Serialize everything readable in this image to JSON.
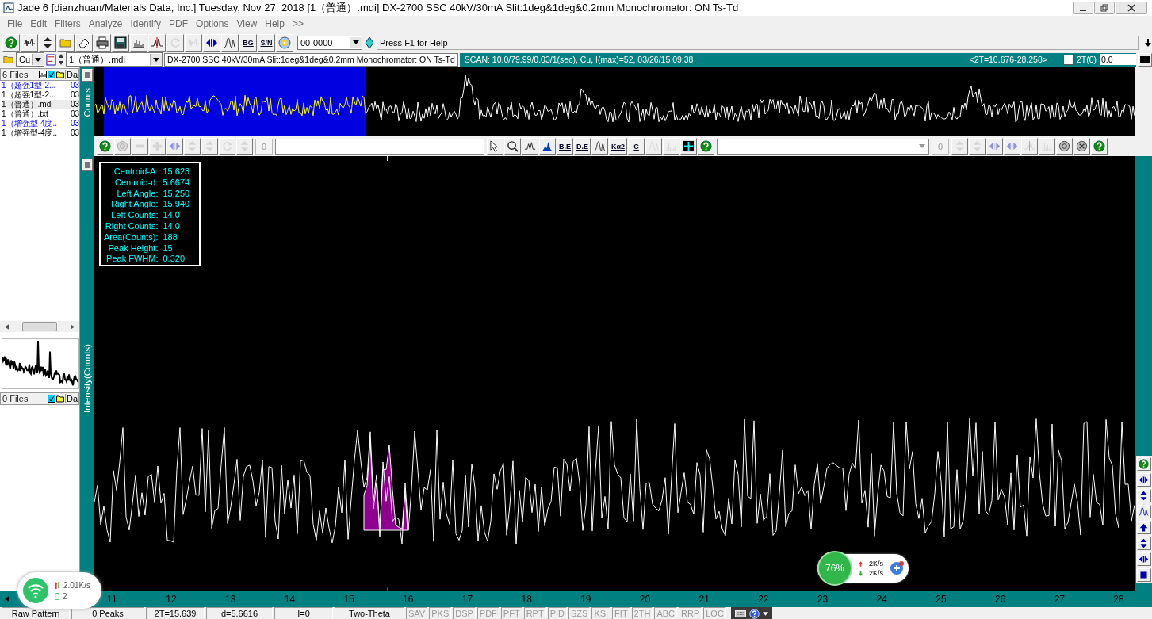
{
  "window": {
    "title": "Jade 6 [dianzhuan/Materials Data, Inc.] Tuesday, Nov 27, 2018 [1（普通）.mdi] DX-2700 SSC 40kV/30mA Slit:1deg&1deg&0.2mm Monochromator: ON Ts-Td"
  },
  "menu": [
    "File",
    "Edit",
    "Filters",
    "Analyze",
    "Identify",
    "PDF",
    "Options",
    "View",
    "Help",
    ">>"
  ],
  "main_toolbar": {
    "buttons": [
      {
        "kind": "help",
        "disabled": false
      },
      {
        "kind": "wave",
        "disabled": false
      },
      {
        "kind": "arrows-v",
        "disabled": false
      },
      {
        "kind": "folder",
        "disabled": false
      },
      {
        "kind": "eraser",
        "disabled": false
      },
      {
        "kind": "printer",
        "disabled": false
      },
      {
        "kind": "save",
        "disabled": false
      },
      {
        "kind": "bars",
        "disabled": false
      },
      {
        "kind": "marker",
        "disabled": false
      },
      {
        "kind": "refresh",
        "disabled": true
      },
      {
        "kind": "wave",
        "disabled": true
      },
      {
        "kind": "arrows-h",
        "disabled": false
      },
      {
        "kind": "peaks",
        "disabled": false
      },
      {
        "kind": "text",
        "label": "BG",
        "disabled": false
      },
      {
        "kind": "text",
        "label": "S/N",
        "disabled": false
      },
      {
        "kind": "disc",
        "disabled": false
      }
    ],
    "pattern_select": "00-0000",
    "help_field": "Press F1 for Help"
  },
  "pattern_bar": {
    "radiation_select": "Cu",
    "file_select": "1（普通）.mdi",
    "description": "DX-2700 SSC 40kV/30mA Slit:1deg&1deg&0.2mm Monochromator: ON Ts-Td",
    "scan_info": "SCAN: 10.0/79.99/0.03/1(sec), Cu, I(max)=52, 03/26/15 09:38",
    "range": "<2T=10.676-28.258>",
    "zero_label": "2T(0)",
    "zero_checked": false,
    "zero_value": "0.0"
  },
  "file_panel": {
    "header": "6 Files",
    "column_2": "Da",
    "files": [
      {
        "name": "1（超强1型-2...",
        "column_2": "03",
        "highlighted": true,
        "selected": false
      },
      {
        "name": "1（超强1型-2...",
        "column_2": "03",
        "highlighted": false,
        "selected": false
      },
      {
        "name": "1（普通）.mdi",
        "column_2": "03",
        "highlighted": false,
        "selected": true
      },
      {
        "name": "1（普通）.txt",
        "column_2": "03",
        "highlighted": false,
        "selected": false
      },
      {
        "name": "1（增强型-4度..",
        "column_2": "03",
        "highlighted": true,
        "selected": false
      },
      {
        "name": "1（增强型-4度..",
        "column_2": "03",
        "highlighted": false,
        "selected": false
      }
    ],
    "empty_header": "0 Files",
    "empty_column_2": "Da"
  },
  "axis_labels": {
    "overview": "Counts",
    "main": "Intensity(Counts)"
  },
  "plot_toolbar": {
    "left_buttons": [
      {
        "kind": "help",
        "disabled": false
      },
      {
        "kind": "circle",
        "disabled": true
      },
      {
        "kind": "minus",
        "disabled": true
      },
      {
        "kind": "plus",
        "disabled": true
      },
      {
        "kind": "arrows-h",
        "disabled": true
      },
      {
        "kind": "arrows-v",
        "disabled": true
      },
      {
        "kind": "arrows-v",
        "disabled": true
      },
      {
        "kind": "refresh",
        "disabled": true
      },
      {
        "kind": "arrows-v",
        "disabled": true
      }
    ],
    "counter": "0",
    "middle_buttons": [
      {
        "kind": "cursor",
        "disabled": false
      },
      {
        "kind": "search",
        "disabled": false
      },
      {
        "kind": "marker",
        "disabled": false
      },
      {
        "kind": "fill",
        "disabled": false
      },
      {
        "kind": "text",
        "label": "B.E",
        "disabled": false
      },
      {
        "kind": "text",
        "label": "D.E",
        "disabled": false
      },
      {
        "kind": "peaks",
        "disabled": false
      },
      {
        "kind": "text",
        "label": "Kα2",
        "disabled": false
      },
      {
        "kind": "text",
        "label": "C",
        "disabled": false
      },
      {
        "kind": "peaks",
        "disabled": true
      },
      {
        "kind": "bars",
        "disabled": true
      },
      {
        "kind": "grid",
        "disabled": false
      },
      {
        "kind": "help",
        "disabled": false
      }
    ],
    "counter_2": "0",
    "right_buttons": [
      {
        "kind": "arrows-v",
        "disabled": true
      },
      {
        "kind": "arrows-v",
        "disabled": true
      },
      {
        "kind": "arrows-h",
        "disabled": true
      },
      {
        "kind": "arrows-h",
        "disabled": true
      },
      {
        "kind": "marker",
        "disabled": true
      },
      {
        "kind": "bars",
        "disabled": true
      },
      {
        "kind": "circle",
        "disabled": false
      },
      {
        "kind": "circle-x",
        "disabled": false
      },
      {
        "kind": "help",
        "disabled": false
      }
    ]
  },
  "peak_info": [
    {
      "label": "Centroid-A:",
      "value": "15.623"
    },
    {
      "label": "Centroid-d:",
      "value": "5.6674"
    },
    {
      "label": "Left Angle:",
      "value": "15.250"
    },
    {
      "label": "Right Angle:",
      "value": "15.940"
    },
    {
      "label": "Left Counts:",
      "value": "14.0"
    },
    {
      "label": "Right Counts:",
      "value": "14.0"
    },
    {
      "label": "Area(Counts):",
      "value": "188"
    },
    {
      "label": "Peak Height:",
      "value": "15"
    },
    {
      "label": "Peak FWHM:",
      "value": "0.320"
    }
  ],
  "side_buttons": [
    {
      "kind": "help",
      "disabled": false
    },
    {
      "kind": "arrows-h",
      "disabled": false
    },
    {
      "kind": "arrows-v",
      "disabled": false
    },
    {
      "kind": "peaks",
      "disabled": false
    },
    {
      "kind": "up",
      "disabled": false
    },
    {
      "kind": "arrows-v",
      "disabled": false
    },
    {
      "kind": "arrows-h",
      "disabled": false
    },
    {
      "kind": "stop",
      "disabled": false
    }
  ],
  "x_axis": {
    "labels": [
      "11",
      "12",
      "13",
      "14",
      "15",
      "16",
      "17",
      "18",
      "19",
      "20",
      "21",
      "22",
      "23",
      "24",
      "25",
      "26",
      "27",
      "28"
    ]
  },
  "status_bar": {
    "fields": [
      "Raw Pattern",
      "0 Peaks",
      "2T=15.639",
      "d=5.6616",
      "I=0",
      "Two-Theta"
    ],
    "indicators": [
      "SAV",
      "PKS",
      "DSP",
      "PDF",
      "PFT",
      "RPT",
      "PID",
      "SZS",
      "KSI",
      "FIT",
      "2TH",
      "ABC",
      "RRP",
      "LOC"
    ]
  },
  "network_widget": {
    "speed": "2.01K/s",
    "count": "2"
  },
  "speed_widget": {
    "percent": "76%",
    "upload": "2K/s",
    "download": "2K/s"
  }
}
